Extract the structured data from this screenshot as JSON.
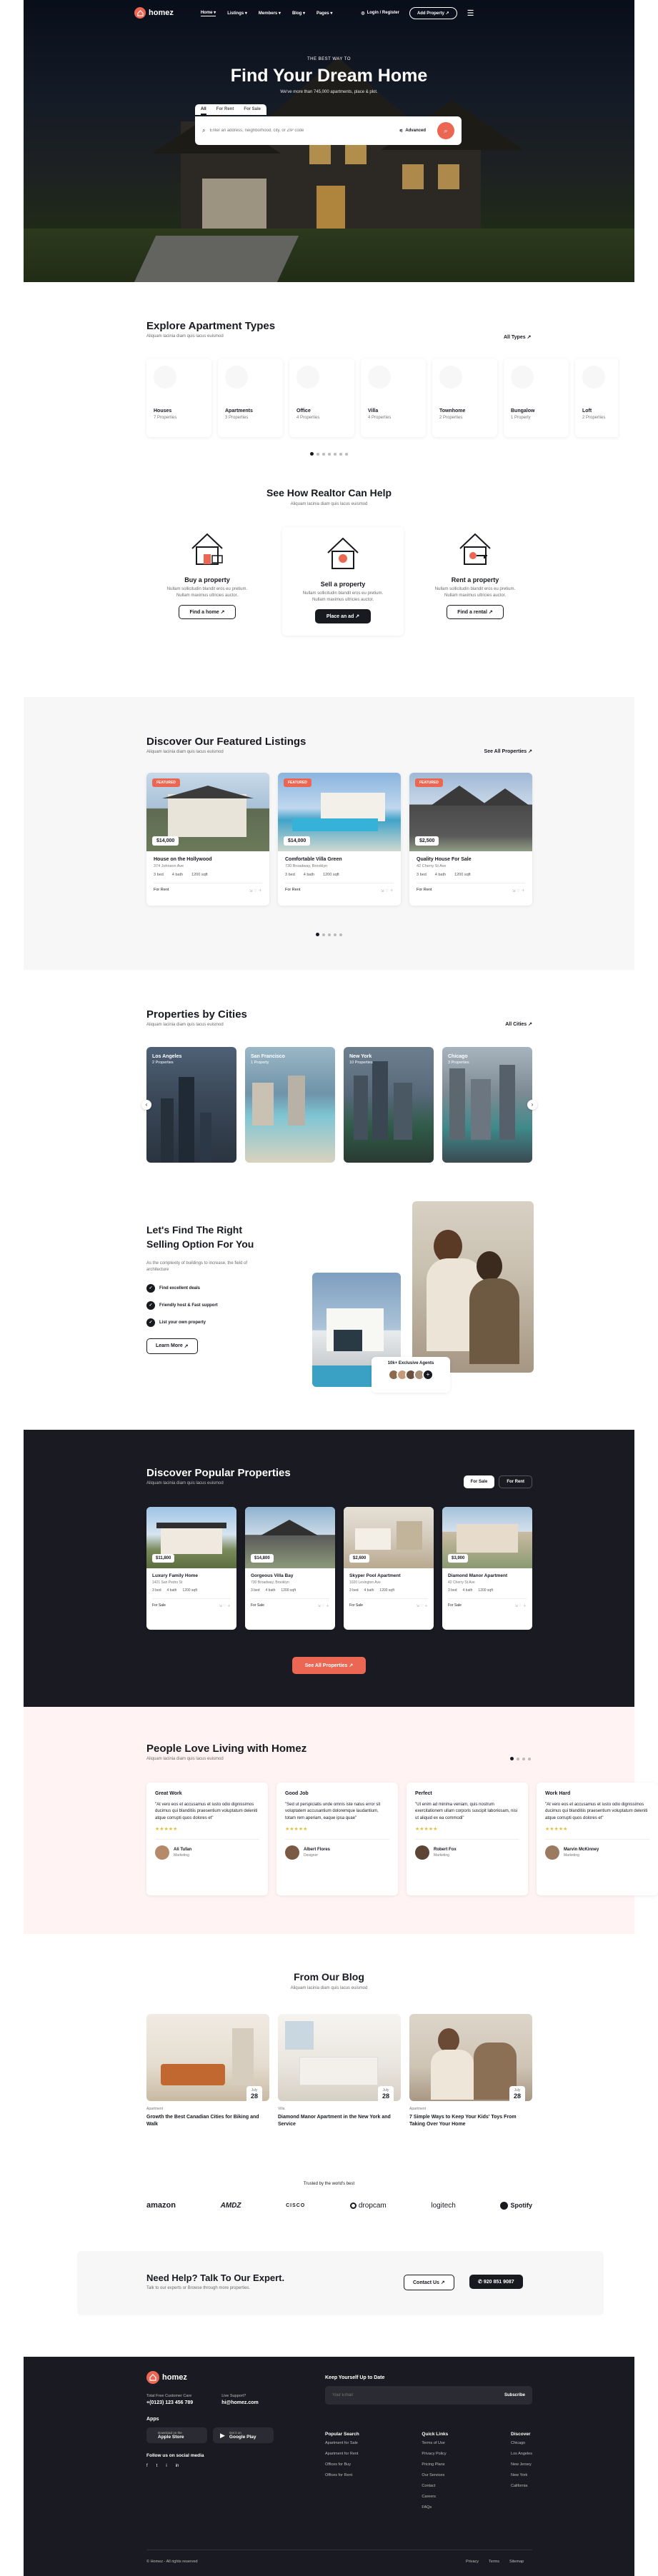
{
  "colors": {
    "accent": "#eb6753",
    "dark": "#1a1a22",
    "pink": "#fff4f3"
  },
  "nav": {
    "logo": "homez",
    "items": [
      "Home",
      "Listings",
      "Members",
      "Blog",
      "Pages"
    ],
    "login": "Login / Register",
    "add_property": "Add Property"
  },
  "hero": {
    "eyebrow": "THE BEST WAY TO",
    "title": "Find Your Dream Home",
    "subtitle": "We've more than 745,000 apartments, place & plot.",
    "tabs": [
      "All",
      "For Rent",
      "For Sale"
    ],
    "search_placeholder": "Enter an address, neighborhood, city, or ZIP code",
    "advanced": "Advanced"
  },
  "apt_types": {
    "title": "Explore Apartment Types",
    "subtitle": "Aliquam lacinia diam quis lacus euismod",
    "link": "All Types",
    "items": [
      {
        "name": "Houses",
        "count": "7 Properties"
      },
      {
        "name": "Apartments",
        "count": "3 Properties"
      },
      {
        "name": "Office",
        "count": "4 Properties"
      },
      {
        "name": "Villa",
        "count": "4 Properties"
      },
      {
        "name": "Townhome",
        "count": "2 Properties"
      },
      {
        "name": "Bungalow",
        "count": "1 Property"
      },
      {
        "name": "Loft",
        "count": "2 Properties"
      }
    ]
  },
  "help": {
    "title": "See How Realtor Can Help",
    "subtitle": "Aliquam lacinia diam quis lacus euismod",
    "items": [
      {
        "title": "Buy a property",
        "text": "Nullam sollicitudin blandit eros eu pretium. Nullam maximus ultricies auctor.",
        "cta": "Find a home"
      },
      {
        "title": "Sell a property",
        "text": "Nullam sollicitudin blandit eros eu pretium. Nullam maximus ultricies auctor.",
        "cta": "Place an ad"
      },
      {
        "title": "Rent a property",
        "text": "Nullam sollicitudin blandit eros eu pretium. Nullam maximus ultricies auctor.",
        "cta": "Find a rental"
      }
    ]
  },
  "featured": {
    "title": "Discover Our Featured Listings",
    "subtitle": "Aliquam lacinia diam quis lacus euismod",
    "link": "See All Properties",
    "badge": "FEATURED",
    "items": [
      {
        "price": "$14,000",
        "title": "House on the Hollywood",
        "addr": "374 Johnson Ave",
        "beds": "3 bed",
        "baths": "4 bath",
        "sqft": "1200 sqft",
        "status": "For Rent"
      },
      {
        "price": "$14,000",
        "title": "Comfortable Villa Green",
        "addr": "730 Broadway, Brooklyn",
        "beds": "3 bed",
        "baths": "4 bath",
        "sqft": "1200 sqft",
        "status": "For Rent"
      },
      {
        "price": "$2,500",
        "title": "Quality House For Sale",
        "addr": "42 Cherry St Ave",
        "beds": "3 bed",
        "baths": "4 bath",
        "sqft": "1200 sqft",
        "status": "For Rent"
      }
    ]
  },
  "cities": {
    "title": "Properties by Cities",
    "subtitle": "Aliquam lacinia diam quis lacus euismod",
    "link": "All Cities",
    "items": [
      {
        "name": "Los Angeles",
        "count": "2 Properties"
      },
      {
        "name": "San Francisco",
        "count": "1 Property"
      },
      {
        "name": "New York",
        "count": "10 Properties"
      },
      {
        "name": "Chicago",
        "count": "3 Properties"
      }
    ]
  },
  "selling": {
    "title": "Let's Find The Right Selling Option For You",
    "text": "As the complexity of buildings to increase, the field of architecture",
    "points": [
      "Find excellent deals",
      "Friendly host & Fast support",
      "List your own property"
    ],
    "cta": "Learn More",
    "agents": "10k+ Exclusive Agents"
  },
  "popular": {
    "title": "Discover Popular Properties",
    "subtitle": "Aliquam lacinia diam quis lacus euismod",
    "tabs": [
      "For Sale",
      "For Rent"
    ],
    "cta": "See All Properties",
    "items": [
      {
        "price": "$11,800",
        "title": "Luxury Family Home",
        "addr": "1421 San Pedro St",
        "beds": "3 bed",
        "baths": "4 bath",
        "sqft": "1200 sqft",
        "status": "For Sale"
      },
      {
        "price": "$14,800",
        "title": "Gorgeous Villa Bay",
        "addr": "730 Broadway, Brooklyn",
        "beds": "3 bed",
        "baths": "4 bath",
        "sqft": "1200 sqft",
        "status": "For Sale"
      },
      {
        "price": "$2,600",
        "title": "Skyper Pool Apartment",
        "addr": "1020 Lexington Ave",
        "beds": "3 bed",
        "baths": "4 bath",
        "sqft": "1200 sqft",
        "status": "For Sale"
      },
      {
        "price": "$3,900",
        "title": "Diamond Manor Apartment",
        "addr": "42 Cherry St Ave",
        "beds": "3 bed",
        "baths": "4 bath",
        "sqft": "1200 sqft",
        "status": "For Sale"
      }
    ]
  },
  "testimonials": {
    "title": "People Love Living with Homez",
    "subtitle": "Aliquam lacinia diam quis lacus euismod",
    "items": [
      {
        "head": "Great Work",
        "quote": "\"At vero eos et accusamus et iusto odio dignissimos ducimus qui blanditiis praesentium voluptatum deleniti atque corrupti quos dolores et\"",
        "name": "Ali Tufan",
        "role": "Marketing"
      },
      {
        "head": "Good Job",
        "quote": "\"Sed ut perspiciatis unde omnis iste natus error sit voluptatem accusantium doloremque laudantium, totam rem aperiam, eaque ipsa quae\"",
        "name": "Albert Flores",
        "role": "Designer"
      },
      {
        "head": "Perfect",
        "quote": "\"Ut enim ad minima veniam, quis nostrum exercitationem ullam corporis suscipit laboriosam, nisi ut aliquid ex ea commodi\"",
        "name": "Robert Fox",
        "role": "Marketing"
      },
      {
        "head": "Work Hard",
        "quote": "\"At vero eos et accusamus et iusto odio dignissimos ducimus qui blanditiis praesentium voluptatum deleniti atque corrupti quos dolores et\"",
        "name": "Marvin McKinney",
        "role": "Marketing"
      }
    ]
  },
  "blog": {
    "title": "From Our Blog",
    "subtitle": "Aliquam lacinia diam quis lacus euismod",
    "items": [
      {
        "cat": "Apartment",
        "month": "July",
        "day": "28",
        "title": "Growth the Best Canadian Cities for Biking and Walk"
      },
      {
        "cat": "Villa",
        "month": "July",
        "day": "28",
        "title": "Diamond Manor Apartment in the New York and Service"
      },
      {
        "cat": "Apartment",
        "month": "July",
        "day": "28",
        "title": "7 Simple Ways to Keep Your Kids' Toys From Taking Over Your Home"
      }
    ]
  },
  "trusted": {
    "title": "Trusted by the world's best",
    "brands": [
      "amazon",
      "AMDZ",
      "CISCO",
      "dropcam",
      "logitech",
      "Spotify"
    ]
  },
  "cta_band": {
    "title": "Need Help? Talk To Our Expert.",
    "subtitle": "Talk to our experts or Browse through more properties.",
    "contact": "Contact Us",
    "phone": "920 851 9087"
  },
  "footer": {
    "logo": "homez",
    "support_label": "Total Free Customer Care",
    "support_value": "+(0123) 123 456 789",
    "email_label": "Live Support?",
    "email_value": "hi@homez.com",
    "apps_title": "Apps",
    "apps": [
      {
        "small": "Download on the",
        "big": "Apple Store"
      },
      {
        "small": "Get it on",
        "big": "Google Play"
      }
    ],
    "social_title": "Follow us on social media",
    "social": [
      "f",
      "t",
      "i",
      "in"
    ],
    "newsletter_title": "Keep Yourself Up to Date",
    "newsletter_placeholder": "Your Email",
    "subscribe": "Subscribe",
    "cols": [
      {
        "title": "Popular Search",
        "links": [
          "Apartment for Sale",
          "Apartment for Rent",
          "Offices for Buy",
          "Offices for Rent"
        ]
      },
      {
        "title": "Quick Links",
        "links": [
          "Terms of Use",
          "Privacy Policy",
          "Pricing Plans",
          "Our Services",
          "Contact",
          "Careers",
          "FAQs"
        ]
      },
      {
        "title": "Discover",
        "links": [
          "Chicago",
          "Los Angeles",
          "New Jersey",
          "New York",
          "California"
        ]
      }
    ],
    "copyright": "© Homez - All rights reserved",
    "bottom_links": [
      "Privacy",
      "Terms",
      "Sitemap"
    ]
  }
}
